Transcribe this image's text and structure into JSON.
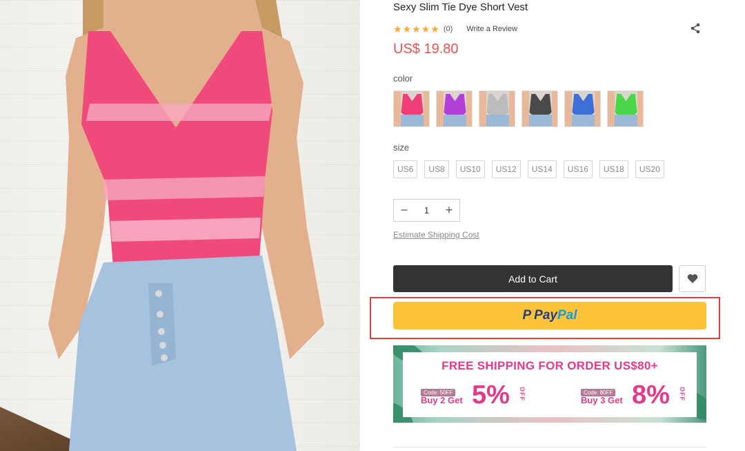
{
  "product": {
    "title": "Sexy Slim Tie Dye Short Vest",
    "rating_count": "(0)",
    "stars": 5,
    "write_review": "Write a Review",
    "price": "US$ 19.80"
  },
  "options": {
    "color_label": "color",
    "colors": [
      {
        "name": "pink",
        "hex": "#ef3f78"
      },
      {
        "name": "purple",
        "hex": "#b23fd8"
      },
      {
        "name": "grey",
        "hex": "#bcbcbc"
      },
      {
        "name": "black",
        "hex": "#4a4a4a"
      },
      {
        "name": "blue",
        "hex": "#3d6fd6"
      },
      {
        "name": "green",
        "hex": "#49d64a"
      }
    ],
    "size_label": "size",
    "sizes": [
      "US6",
      "US8",
      "US10",
      "US12",
      "US14",
      "US16",
      "US18",
      "US20"
    ]
  },
  "quantity": {
    "minus": "−",
    "value": "1",
    "plus": "+"
  },
  "links": {
    "estimate_shipping": "Estimate Shipping Cost"
  },
  "actions": {
    "add_to_cart": "Add to Cart",
    "paypal_pay": "Pay",
    "paypal_pal": "Pal",
    "paypal_mark": "P"
  },
  "banner": {
    "headline": "FREE SHIPPING FOR ORDER US$80+",
    "offers": [
      {
        "code": "Code: 50FF",
        "buy": "Buy 2 Get",
        "percent": "5%",
        "off": "OFF"
      },
      {
        "code": "Code: 80FF",
        "buy": "Buy 3 Get",
        "percent": "8%",
        "off": "OFF"
      }
    ]
  },
  "colors": {
    "price": "#f0504f",
    "star": "#f7a93b",
    "cart_button": "#333333",
    "paypal_button": "#fdc33a",
    "highlight_border": "#e23b3b",
    "promo_text": "#e23b8b"
  }
}
